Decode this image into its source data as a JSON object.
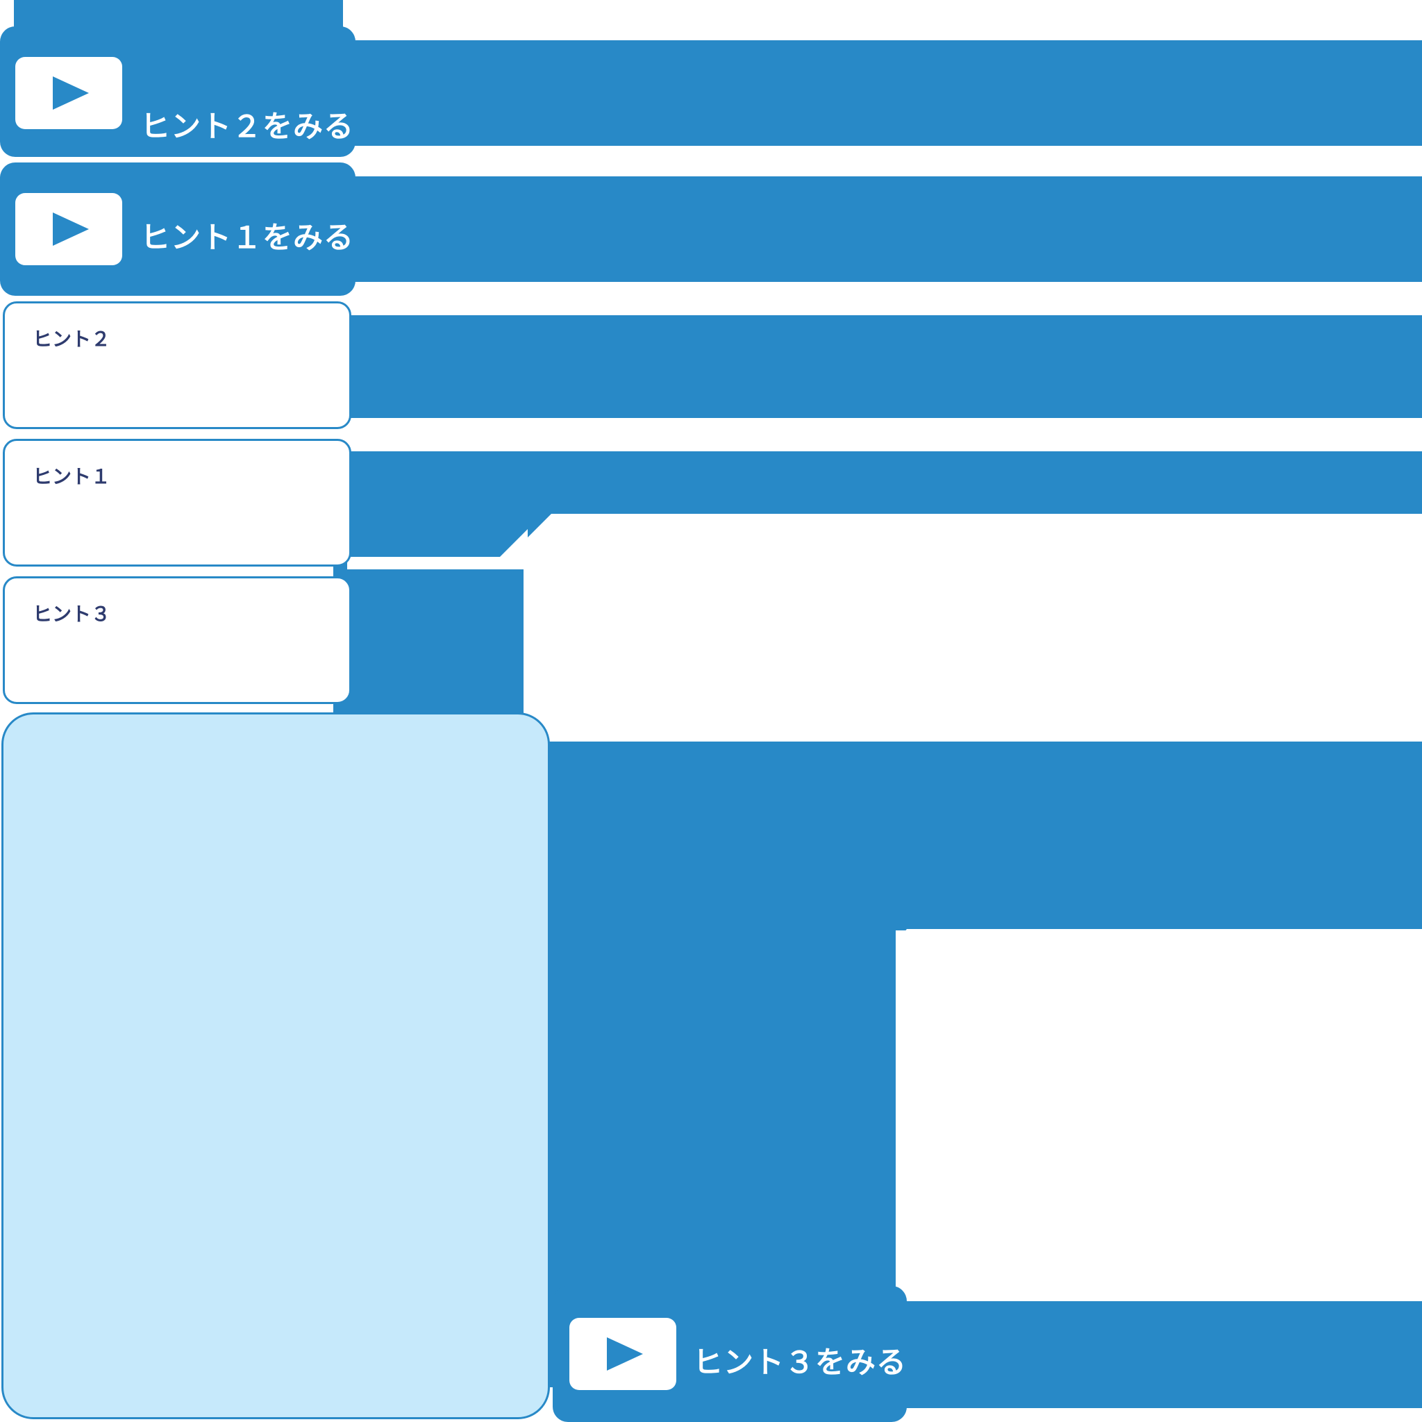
{
  "colors": {
    "primary_blue": "#2889c7",
    "light_panel": "#c6e9fb",
    "card_text": "#2e3b6e",
    "white": "#ffffff"
  },
  "buttons": {
    "hint2": {
      "label": "ヒント２をみる",
      "icon": "play-icon"
    },
    "hint1": {
      "label": "ヒント１をみる",
      "icon": "play-icon"
    },
    "hint3": {
      "label": "ヒント３をみる",
      "icon": "play-icon"
    }
  },
  "cards": {
    "hint2": {
      "title": "ヒント２"
    },
    "hint1": {
      "title": "ヒント１"
    },
    "hint3": {
      "title": "ヒント３"
    }
  }
}
